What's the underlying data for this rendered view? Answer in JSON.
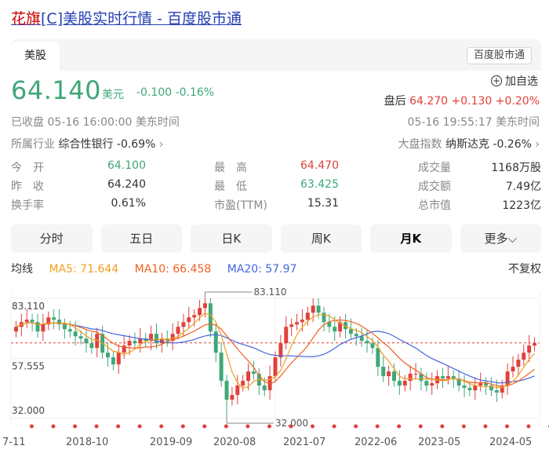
{
  "page_title_prefix": "花旗",
  "page_title_rest": "[C]美股实时行情 - 百度股市通",
  "tabs": {
    "active": "美股",
    "source_badge": "百度股市通"
  },
  "quote": {
    "price": "64.140",
    "currency": "美元",
    "change": "-0.100 -0.16%",
    "watch_label": "加自选",
    "after_label": "盘后",
    "after_value": "64.270 +0.130 +0.20%",
    "status": "已收盘   05-16 16:00:00   美东时间",
    "after_time": "05-16 19:55:17   美东时间",
    "industry_label": "所属行业",
    "industry_value": "综合性银行 -0.69%",
    "index_label": "大盘指数",
    "index_value": "纳斯达克 -0.26%"
  },
  "stats": [
    [
      {
        "l": "今　开",
        "v": "64.100",
        "c": "green"
      },
      {
        "l": "最　高",
        "v": "64.470",
        "c": "red"
      },
      {
        "l": "成交量",
        "v": "1168万股",
        "c": ""
      }
    ],
    [
      {
        "l": "昨　收",
        "v": "64.240",
        "c": ""
      },
      {
        "l": "最　低",
        "v": "63.425",
        "c": "green"
      },
      {
        "l": "成交额",
        "v": "7.49亿",
        "c": ""
      }
    ],
    [
      {
        "l": "换手率",
        "v": "0.61%",
        "c": ""
      },
      {
        "l": "市盈(TTM)",
        "v": "15.31",
        "c": ""
      },
      {
        "l": "总市值",
        "v": "1223亿",
        "c": ""
      }
    ]
  ],
  "periods": [
    "分时",
    "五日",
    "日K",
    "周K",
    "月K",
    "更多"
  ],
  "active_period": "月K",
  "ma": {
    "label": "均线",
    "ma5": "MA5: 71.644",
    "ma10": "MA10: 66.458",
    "ma20": "MA20: 57.97",
    "adjust": "不复权"
  },
  "colors": {
    "up": "#e0403b",
    "down": "#3fa77a",
    "ma5": "#f0a020",
    "ma10": "#f06020",
    "ma20": "#4466dd",
    "link": "#2440b3"
  },
  "chart_data": {
    "type": "candlestick",
    "y_ticks": [
      "83.110",
      "57.555",
      "32.000"
    ],
    "ylim": [
      32.0,
      83.11
    ],
    "high_label": "83.110",
    "low_label": "32.000",
    "x_labels": [
      "7-11",
      "2018-10",
      "2019-09",
      "2020-08",
      "2021-07",
      "2022-06",
      "2023-05",
      "2024-05"
    ],
    "reference_price": 64.14,
    "closes": [
      71,
      73,
      74,
      73,
      69,
      72,
      75,
      74,
      72,
      70,
      69,
      67,
      66,
      64,
      62,
      68,
      60,
      58,
      55,
      60,
      63,
      65,
      64,
      66,
      65,
      68,
      64,
      66,
      65,
      68,
      71,
      73,
      75,
      76,
      79,
      81,
      69,
      60,
      48,
      40,
      42,
      46,
      48,
      52,
      51,
      46,
      44,
      50,
      58,
      64,
      71,
      72,
      73,
      74,
      77,
      80,
      77,
      73,
      71,
      69,
      73,
      70,
      68,
      67,
      65,
      64,
      62,
      54,
      50,
      52,
      48,
      46,
      48,
      51,
      51,
      48,
      46,
      47,
      50,
      49,
      50,
      49,
      46,
      45,
      44,
      46,
      47,
      46,
      44,
      43,
      46,
      52,
      54,
      57,
      60,
      63,
      64
    ]
  }
}
